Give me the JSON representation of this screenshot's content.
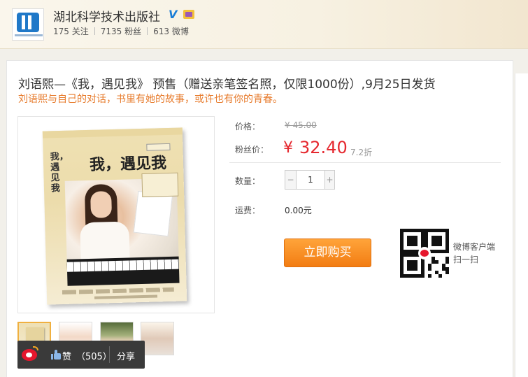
{
  "header": {
    "publisher_name": "湖北科学技术出版社",
    "verified_badge": "V",
    "stats": {
      "following": "175 关注",
      "fans": "7135 粉丝",
      "weibo": "613 微博"
    }
  },
  "product": {
    "title": "刘语熙—《我，遇见我》 预售（赠送亲笔签名照，仅限1000份）,9月25日发货",
    "subtitle": "刘语熙与自己的对话，书里有她的故事，或许也有你的青春。",
    "book_cover_title": "我，遇见我",
    "book_cover_vertical": "我，遇见我"
  },
  "pricing": {
    "price_label": "价格：",
    "original_price": "¥ 45.00",
    "fan_price_label": "粉丝价：",
    "fan_price_currency": "¥",
    "fan_price": "32.40",
    "discount": "7.2折",
    "quantity_label": "数量：",
    "quantity_value": "1",
    "minus": "−",
    "plus": "+",
    "shipping_label": "运费：",
    "shipping_value": "0.00元"
  },
  "actions": {
    "buy_button": "立即购买",
    "qr_caption": "微博客户端扫一扫"
  },
  "share_bar": {
    "like_label": "赞",
    "like_count": "（505）",
    "share_label": "分享"
  },
  "thumbnails": [
    "cover",
    "portrait-1",
    "portrait-2",
    "portrait-3"
  ],
  "icons": [
    "weibo-icon",
    "like-icon",
    "qr-code-icon",
    "verified-v-icon",
    "tv-badge-icon"
  ],
  "colors": {
    "sale_price": "#e5282f",
    "subtitle": "#e77c2e",
    "buy_button": "#f58b1f",
    "verified": "#1a7dd6"
  }
}
